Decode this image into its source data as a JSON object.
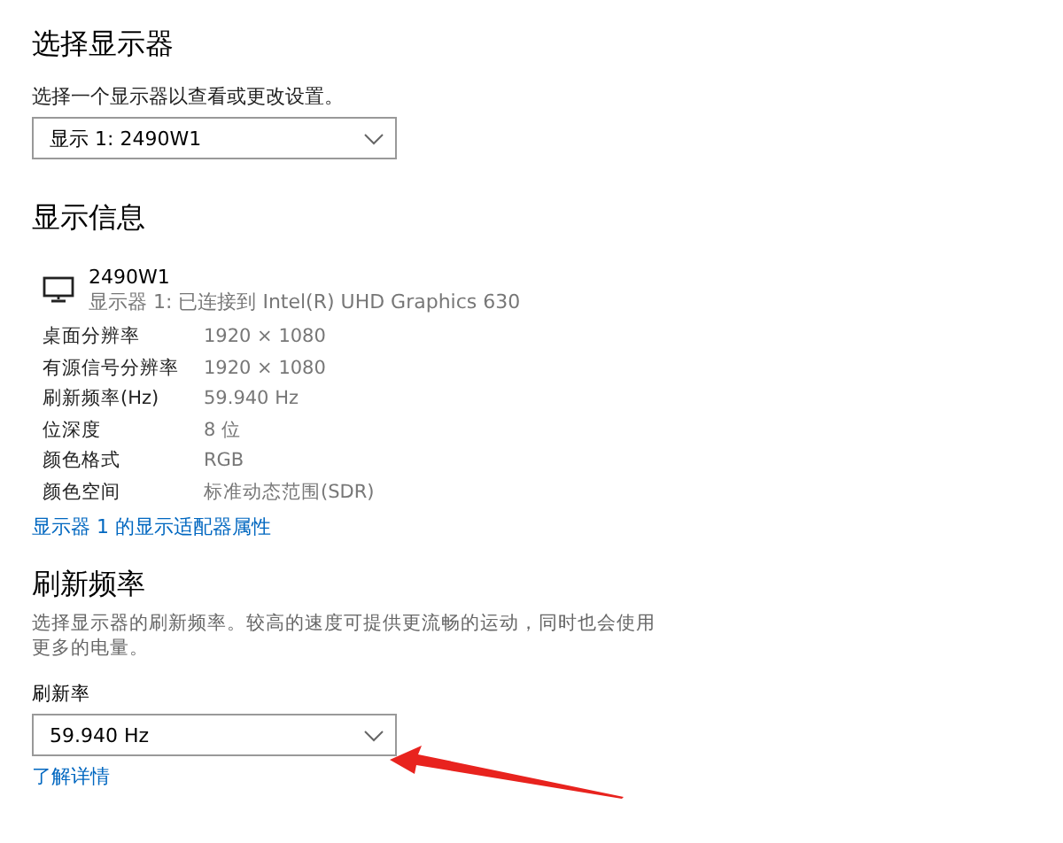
{
  "select_display": {
    "title": "选择显示器",
    "description": "选择一个显示器以查看或更改设置。",
    "dropdown": {
      "value": "显示 1: 2490W1"
    }
  },
  "display_info": {
    "title": "显示信息",
    "monitor": {
      "name": "2490W1",
      "connection": "显示器 1: 已连接到 Intel(R) UHD Graphics 630"
    },
    "rows": [
      {
        "label": "桌面分辨率",
        "value": "1920 × 1080"
      },
      {
        "label": "有源信号分辨率",
        "value": "1920 × 1080"
      },
      {
        "label": "刷新频率(Hz)",
        "value": "59.940 Hz"
      },
      {
        "label": "位深度",
        "value": "8 位"
      },
      {
        "label": "颜色格式",
        "value": "RGB"
      },
      {
        "label": "颜色空间",
        "value": "标准动态范围(SDR)"
      }
    ],
    "link": "显示器 1 的显示适配器属性"
  },
  "refresh_rate": {
    "title": "刷新频率",
    "description": "选择显示器的刷新频率。较高的速度可提供更流畅的运动，同时也会使用更多的电量。",
    "field_label": "刷新率",
    "dropdown": {
      "value": "59.940 Hz"
    },
    "link": "了解详情"
  }
}
